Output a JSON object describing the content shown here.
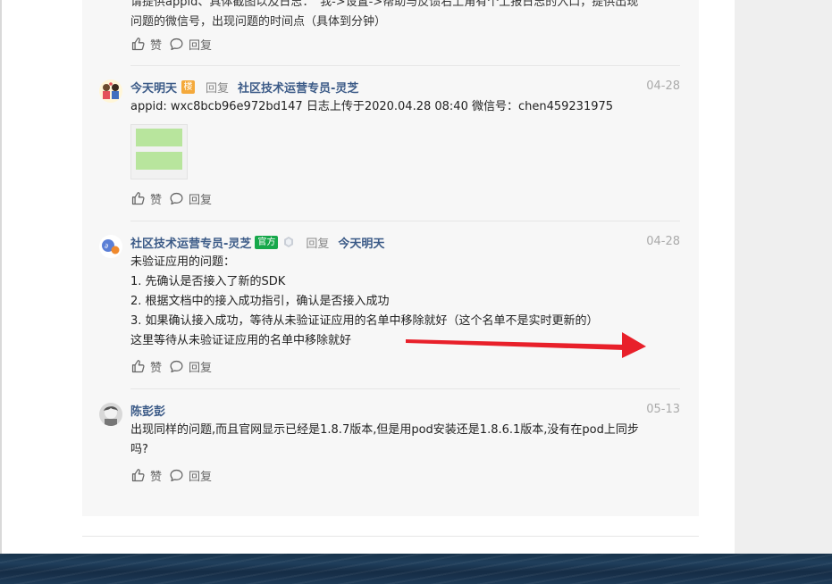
{
  "top": {
    "cut_text": [
      "请提供appid、具体截图以及日志：“我->设置->帮助与反馈右上角有个上报日志的入口，提供出现",
      "问题的微信号，出现问题的时间点（具体到分钟）"
    ],
    "like_label": "赞",
    "reply_label": "回复"
  },
  "comments": [
    {
      "author": "今天明天",
      "badge": "楼",
      "reply_word": "回复",
      "reply_to": "社区技术运营专员-灵芝",
      "date": "04-28",
      "lines": [
        "appid: wxc8bcb96e972bd147   日志上传于2020.04.28    08:40  微信号：chen459231975"
      ],
      "like_label": "赞",
      "reply_label": "回复"
    },
    {
      "author": "社区技术运营专员-灵芝",
      "badge": "官方",
      "reply_word": "回复",
      "reply_to": "今天明天",
      "date": "04-28",
      "lines": [
        "未验证应用的问题：",
        "1. 先确认是否接入了新的SDK",
        "2. 根据文档中的接入成功指引，确认是否接入成功",
        "3. 如果确认接入成功，等待从未验证证应用的名单中移除就好（这个名单不是实时更新的）",
        "这里等待从未验证证应用的名单中移除就好"
      ],
      "like_label": "赞",
      "reply_label": "回复"
    },
    {
      "author": "陈彭彭",
      "date": "05-13",
      "lines": [
        "出现同样的问题,而且官网显示已经是1.8.7版本,但是用pod安装还是1.8.6.1版本,没有在pod上同步",
        "吗?"
      ],
      "like_label": "赞",
      "reply_label": "回复"
    }
  ],
  "colors": {
    "link": "#3b5a87",
    "official_badge": "#17a84b",
    "floor_badge": "#f4a93b",
    "annotation_arrow": "#e8202a"
  },
  "icons": [
    "thumbs-up-icon",
    "comment-bubble-icon",
    "level-diamond-icon"
  ]
}
